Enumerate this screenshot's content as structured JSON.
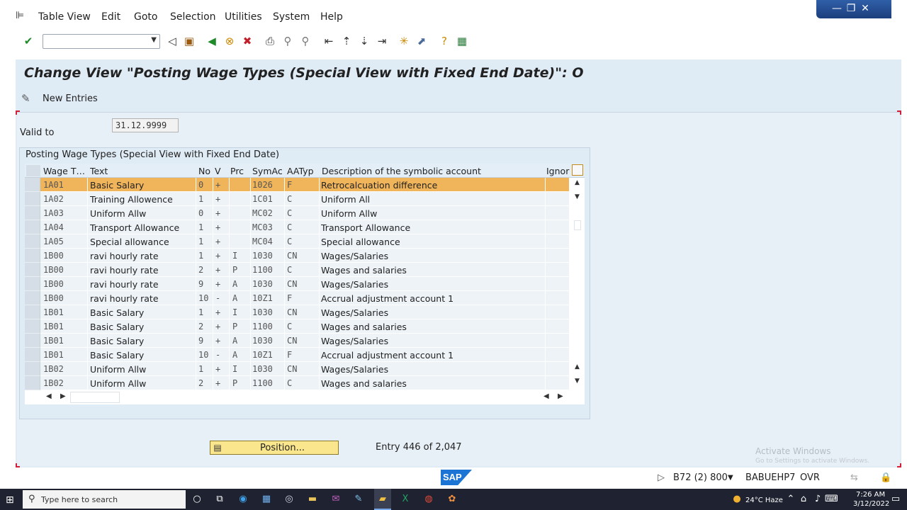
{
  "menu": [
    "Table View",
    "Edit",
    "Goto",
    "Selection",
    "Utilities",
    "System",
    "Help"
  ],
  "window_controls": {
    "minimize": "—",
    "maximize": "❐",
    "close": "✕"
  },
  "toolbar": {
    "icons": [
      "enter-icon",
      "back-nav-icon",
      "save-icon",
      "back-icon",
      "exit-icon",
      "cancel-icon",
      "print-icon",
      "find-icon",
      "find-next-icon",
      "first-page-icon",
      "prev-page-icon",
      "next-page-icon",
      "last-page-icon",
      "create-session-icon",
      "shortcut-icon",
      "help-icon",
      "customize-layout-icon"
    ],
    "command_value": ""
  },
  "title": "Change View \"Posting Wage Types (Special View with Fixed End Date)\": O",
  "app_toolbar": {
    "new_entries": "New Entries"
  },
  "valid_to": {
    "label": "Valid to",
    "value": "31.12.9999"
  },
  "table": {
    "title": "Posting Wage Types (Special View with Fixed End Date)",
    "columns": [
      "Wage T…",
      "Text",
      "No",
      "V",
      "Prc",
      "SymAc",
      "AATyp",
      "Description of the symbolic account",
      "Ignor"
    ],
    "rows": [
      {
        "wt": "1A01",
        "text": "Basic Salary",
        "no": "0",
        "v": "+",
        "prc": "",
        "sym": "1026",
        "aatyp": "F",
        "desc": "Retrocalcuation difference",
        "highlight": true
      },
      {
        "wt": "1A02",
        "text": "Training Allowence",
        "no": "1",
        "v": "+",
        "prc": "",
        "sym": "1C01",
        "aatyp": "C",
        "desc": "Uniform All"
      },
      {
        "wt": "1A03",
        "text": "Uniform Allw",
        "no": "0",
        "v": "+",
        "prc": "",
        "sym": "MC02",
        "aatyp": "C",
        "desc": "Uniform Allw"
      },
      {
        "wt": "1A04",
        "text": "Transport Allowance",
        "no": "1",
        "v": "+",
        "prc": "",
        "sym": "MC03",
        "aatyp": "C",
        "desc": "Transport Allowance"
      },
      {
        "wt": "1A05",
        "text": "Special allowance",
        "no": "1",
        "v": "+",
        "prc": "",
        "sym": "MC04",
        "aatyp": "C",
        "desc": "Special allowance"
      },
      {
        "wt": "1B00",
        "text": "ravi hourly rate",
        "no": "1",
        "v": "+",
        "prc": "I",
        "sym": "1030",
        "aatyp": "CN",
        "desc": "Wages/Salaries"
      },
      {
        "wt": "1B00",
        "text": "ravi hourly rate",
        "no": "2",
        "v": "+",
        "prc": "P",
        "sym": "1100",
        "aatyp": "C",
        "desc": "Wages and salaries"
      },
      {
        "wt": "1B00",
        "text": "ravi hourly rate",
        "no": "9",
        "v": "+",
        "prc": "A",
        "sym": "1030",
        "aatyp": "CN",
        "desc": "Wages/Salaries"
      },
      {
        "wt": "1B00",
        "text": "ravi hourly rate",
        "no": "10",
        "v": "-",
        "prc": "A",
        "sym": "10Z1",
        "aatyp": "F",
        "desc": "Accrual adjustment account 1"
      },
      {
        "wt": "1B01",
        "text": "Basic Salary",
        "no": "1",
        "v": "+",
        "prc": "I",
        "sym": "1030",
        "aatyp": "CN",
        "desc": "Wages/Salaries"
      },
      {
        "wt": "1B01",
        "text": "Basic Salary",
        "no": "2",
        "v": "+",
        "prc": "P",
        "sym": "1100",
        "aatyp": "C",
        "desc": "Wages and salaries"
      },
      {
        "wt": "1B01",
        "text": "Basic Salary",
        "no": "9",
        "v": "+",
        "prc": "A",
        "sym": "1030",
        "aatyp": "CN",
        "desc": "Wages/Salaries"
      },
      {
        "wt": "1B01",
        "text": "Basic Salary",
        "no": "10",
        "v": "-",
        "prc": "A",
        "sym": "10Z1",
        "aatyp": "F",
        "desc": "Accrual adjustment account 1"
      },
      {
        "wt": "1B02",
        "text": "Uniform Allw",
        "no": "1",
        "v": "+",
        "prc": "I",
        "sym": "1030",
        "aatyp": "CN",
        "desc": "Wages/Salaries"
      },
      {
        "wt": "1B02",
        "text": "Uniform Allw",
        "no": "2",
        "v": "+",
        "prc": "P",
        "sym": "1100",
        "aatyp": "C",
        "desc": "Wages and salaries"
      }
    ]
  },
  "position_button": "Position...",
  "entry_info": "Entry 446 of 2,047",
  "watermark": {
    "line1": "Activate Windows",
    "line2": "Go to Settings to activate Windows."
  },
  "status_bar": {
    "logo": "SAP",
    "system": "B72 (2) 800",
    "host": "BABUEHP7",
    "mode": "OVR"
  },
  "taskbar": {
    "search_placeholder": "Type here to search",
    "weather": "24°C Haze",
    "time": "7:26 AM",
    "date": "3/12/2022"
  },
  "colors": {
    "highlight_row": "#f0b45a",
    "sap_blue": "#1c74d4",
    "position_button": "#fae68c"
  }
}
